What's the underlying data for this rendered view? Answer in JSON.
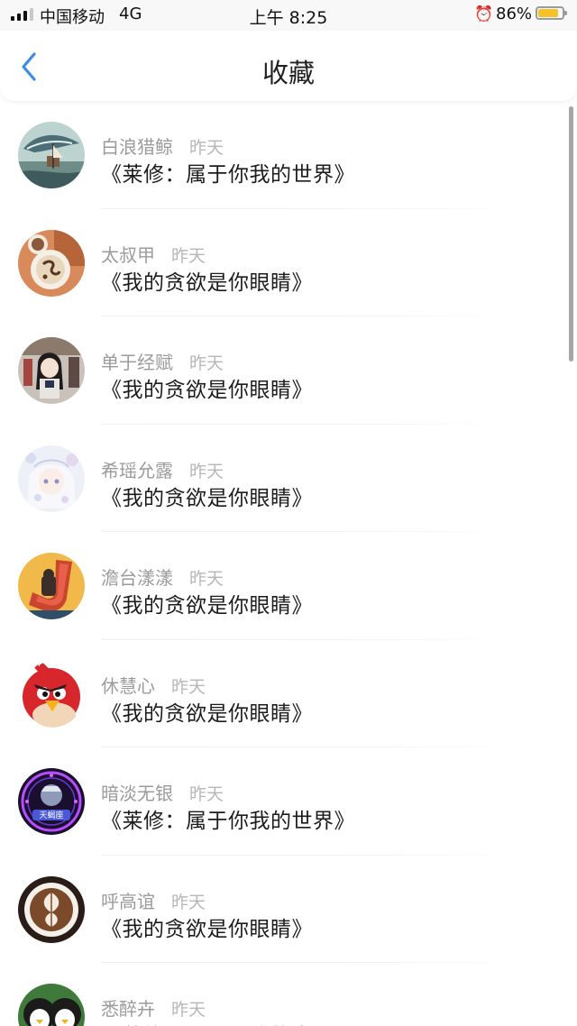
{
  "status_bar": {
    "carrier": "中国移动",
    "network": "4G",
    "time": "上午 8:25",
    "battery": "86%",
    "battery_level": 0.86,
    "alarm_icon": "alarm-clock-icon"
  },
  "nav": {
    "title": "收藏",
    "back_icon": "chevron-left-icon",
    "accent": "#3a8ee6"
  },
  "favorites": [
    {
      "user": "白浪猎鲸",
      "time": "昨天",
      "book": "《莱修：属于你我的世界》",
      "avatar": "whale-ship-avatar"
    },
    {
      "user": "太叔甲",
      "time": "昨天",
      "book": "《我的贪欲是你眼睛》",
      "avatar": "latte-cups-avatar"
    },
    {
      "user": "单于经赋",
      "time": "昨天",
      "book": "《我的贪欲是你眼睛》",
      "avatar": "anime-girl-avatar"
    },
    {
      "user": "希瑶允露",
      "time": "昨天",
      "book": "《我的贪欲是你眼睛》",
      "avatar": "white-hair-girl-avatar"
    },
    {
      "user": "澹台漾漾",
      "time": "昨天",
      "book": "《我的贪欲是你眼睛》",
      "avatar": "letter-j-avatar"
    },
    {
      "user": "休慧心",
      "time": "昨天",
      "book": "《我的贪欲是你眼睛》",
      "avatar": "red-bird-avatar"
    },
    {
      "user": "暗淡无银",
      "time": "昨天",
      "book": "《莱修：属于你我的世界》",
      "avatar": "neon-zodiac-avatar"
    },
    {
      "user": "呼高谊",
      "time": "昨天",
      "book": "《我的贪欲是你眼睛》",
      "avatar": "latte-art-avatar"
    },
    {
      "user": "悉醉卉",
      "time": "昨天",
      "book": "《莱修：属于你我的世界》",
      "avatar": "penguin-doll-avatar"
    }
  ]
}
